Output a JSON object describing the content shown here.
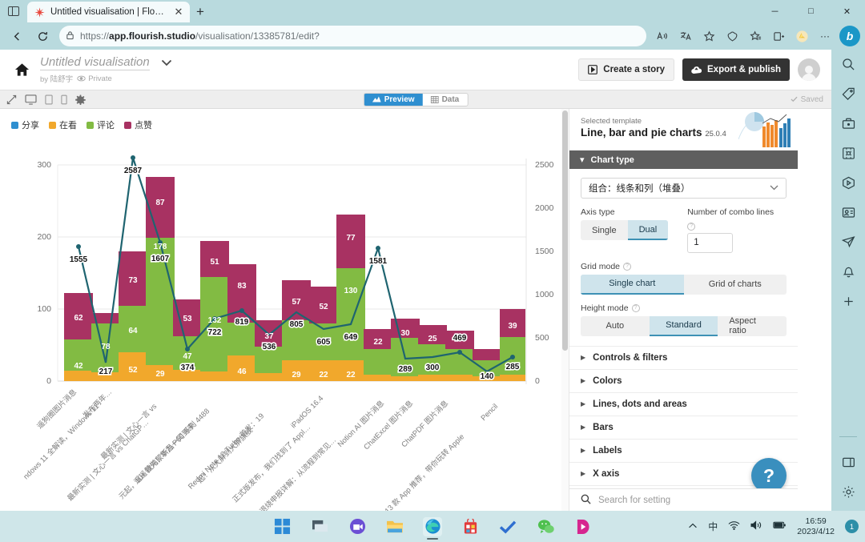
{
  "browser": {
    "tab_title": "Untitled visualisation | Flourish",
    "new_tab_label": "+",
    "close_tab_label": "✕",
    "url_prefix": "https://",
    "url_bold": "app.flourish.studio",
    "url_rest": "/visualisation/13385781/edit?",
    "window_minimize": "－",
    "window_maximize": "□",
    "window_close": "✕"
  },
  "flourish": {
    "title": "Untitled visualisation",
    "byline": "by 陆舒宇",
    "privacy": "Private",
    "create_story": "Create a story",
    "export_publish": "Export & publish",
    "saved_label": "Saved",
    "tabs": {
      "preview": "Preview",
      "data": "Data"
    }
  },
  "settings": {
    "template_label": "Selected template",
    "template_name": "Line, bar and pie charts",
    "template_version": "25.0.4",
    "chart_type_section": "Chart type",
    "chart_type_value": "组合：线条和列（堆叠）",
    "axis_type_label": "Axis type",
    "axis_type_options": [
      "Single",
      "Dual"
    ],
    "axis_type_selected": "Dual",
    "combo_lines_label": "Number of combo lines",
    "combo_lines_value": "1",
    "grid_mode_label": "Grid mode",
    "grid_mode_options": [
      "Single chart",
      "Grid of charts"
    ],
    "grid_mode_selected": "Single chart",
    "height_mode_label": "Height mode",
    "height_mode_options": [
      "Auto",
      "Standard",
      "Aspect ratio"
    ],
    "height_mode_selected": "Standard",
    "accordions": [
      "Controls & filters",
      "Colors",
      "Lines, dots and areas",
      "Bars",
      "Labels",
      "X axis"
    ],
    "search_placeholder": "Search for setting",
    "help_label": "?"
  },
  "taskbar": {
    "time": "16:59",
    "date": "2023/4/12",
    "ime": "中",
    "notification_count": "1"
  },
  "chart_data": {
    "type": "bar",
    "title": "",
    "xlabel": "",
    "ylabel": "",
    "ylim": [
      0,
      300
    ],
    "y2lim": [
      0,
      2500
    ],
    "yticks": [
      0,
      100,
      200,
      300
    ],
    "y2ticks": [
      0,
      500,
      1000,
      1500,
      2000,
      2500
    ],
    "grid": true,
    "legend_position": "top-left",
    "stacked": true,
    "legend": [
      "分享",
      "在看",
      "评论",
      "点赞"
    ],
    "colors": {
      "分享": "#2f8fd0",
      "在看": "#f1a82c",
      "评论": "#82bb43",
      "点赞": "#a83262",
      "line": "#1f6470"
    },
    "categories": [
      "..圈图片消息",
      "...dows 11 全解读，Windows 11 发布两年...",
      "最新实测 | 文心一言 vs 最新实测 | 文心一言 vs ChatGP...",
      "遥遥领先！华为 P60 系列 4488 元起，10+ 款鸿蒙新品一同到来",
      "Redmi Note 12 Turbo 首发：19 起！从大屏到大屏旗舰",
      "正式版发布，我们找到了 Appl... iPadOS 16.4",
      "退烧申报详解：从流程到常见...",
      "Notion AI 图片消息",
      "ChatExcel 图片消息",
      "ChatPDF 图片消息",
      "13 款 App 推荐，带你玩转 Apple Pencil"
    ],
    "series": [
      {
        "name": "在看",
        "values": [
          14,
          11,
          36,
          20,
          14,
          12,
          11,
          19,
          14,
          15,
          13
        ]
      },
      {
        "name": "评论",
        "values": [
          42,
          78,
          64,
          178,
          47,
          132,
          46,
          37,
          57,
          130,
          22
        ]
      },
      {
        "name": "点赞",
        "values": [
          62,
          17,
          73,
          87,
          53,
          51,
          83,
          37,
          57,
          77,
          22
        ]
      }
    ],
    "bar_labels": {
      "在看": [
        "",
        "",
        "52",
        "29",
        "",
        "",
        "46",
        "",
        "29",
        "22",
        "22"
      ],
      "评论": [
        "42",
        "78",
        "64",
        "178",
        "47",
        "132",
        "",
        "",
        "",
        "130",
        ""
      ],
      "点赞": [
        "62",
        "",
        "73",
        "87",
        "53",
        "51",
        "83",
        "37",
        "57",
        "77",
        "22"
      ]
    },
    "line_name": "分享",
    "line_values": [
      1555,
      217,
      2587,
      1607,
      374,
      722,
      819,
      536,
      805,
      605,
      649,
      1581,
      289,
      300,
      469,
      140,
      285
    ],
    "line_labels": [
      "1555",
      "217",
      "2587",
      "1607",
      "374",
      "722",
      "819",
      "536",
      "805",
      "605",
      "649",
      "1581",
      "289",
      "300",
      "469",
      "140",
      "285"
    ],
    "extra_bar_labels": [
      "30",
      "25",
      "39",
      "285"
    ]
  }
}
